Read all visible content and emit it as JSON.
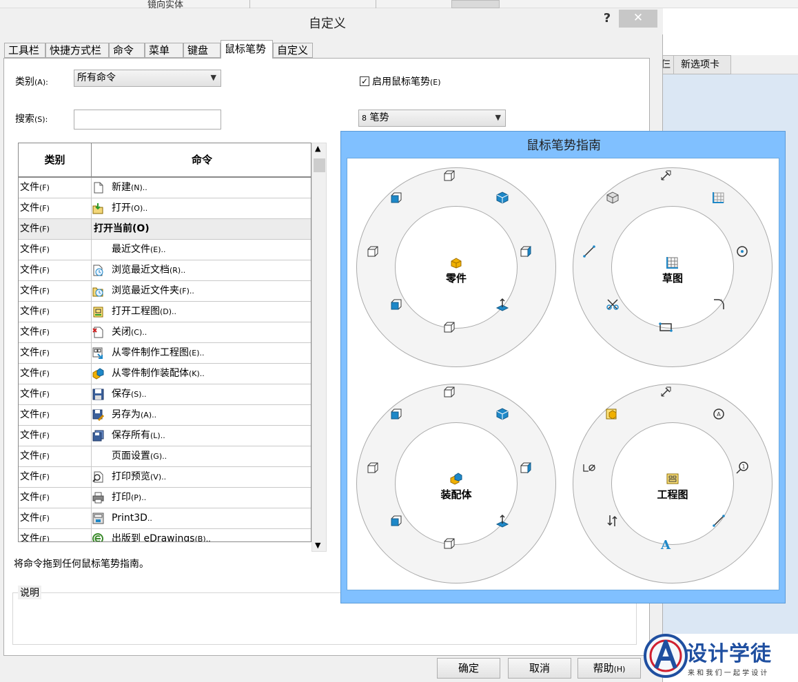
{
  "background": {
    "top_text": "镜向实体",
    "right_tab_partial": "仨",
    "right_tab": "新选项卡"
  },
  "dialog": {
    "title": "自定义",
    "help": "?",
    "close": "✕",
    "tabs": [
      {
        "label": "工具栏"
      },
      {
        "label": "快捷方式栏"
      },
      {
        "label": "命令"
      },
      {
        "label": "菜单"
      },
      {
        "label": "键盘"
      },
      {
        "label": "鼠标笔势"
      },
      {
        "label": "自定义"
      }
    ],
    "active_tab": "鼠标笔势"
  },
  "filters": {
    "category_label": "类别",
    "category_key": "(A):",
    "category_value": "所有命令",
    "search_label": "搜索",
    "search_key": "(S):",
    "search_value": "",
    "enable_label": "启用鼠标笔势",
    "enable_key": "(E)",
    "enable_checked": true,
    "gesture_count": "8",
    "gesture_unit": "笔势"
  },
  "table": {
    "headers": [
      "类别",
      "命令"
    ],
    "rows": [
      {
        "cat": "文件",
        "key": "(F)",
        "cmd": "新建",
        "cmd_key": "(N)..",
        "icon": "new-doc-icon"
      },
      {
        "cat": "文件",
        "key": "(F)",
        "cmd": "打开",
        "cmd_key": "(O)..",
        "icon": "open-icon"
      },
      {
        "cat": "文件",
        "key": "(F)",
        "cmd": "打开当前",
        "cmd_key": "(O)",
        "icon": "",
        "bold": true
      },
      {
        "cat": "文件",
        "key": "(F)",
        "cmd": "最近文件",
        "cmd_key": "(E)..",
        "icon": ""
      },
      {
        "cat": "文件",
        "key": "(F)",
        "cmd": "浏览最近文档",
        "cmd_key": "(R)..",
        "icon": "recent-doc-icon"
      },
      {
        "cat": "文件",
        "key": "(F)",
        "cmd": "浏览最近文件夹",
        "cmd_key": "(F)..",
        "icon": "recent-folder-icon"
      },
      {
        "cat": "文件",
        "key": "(F)",
        "cmd": "打开工程图",
        "cmd_key": "(D)..",
        "icon": "open-drawing-icon"
      },
      {
        "cat": "文件",
        "key": "(F)",
        "cmd": "关闭",
        "cmd_key": "(C)..",
        "icon": "close-doc-icon"
      },
      {
        "cat": "文件",
        "key": "(F)",
        "cmd": "从零件制作工程图",
        "cmd_key": "(E)..",
        "icon": "make-drawing-icon"
      },
      {
        "cat": "文件",
        "key": "(F)",
        "cmd": "从零件制作装配体",
        "cmd_key": "(K)..",
        "icon": "make-assembly-icon"
      },
      {
        "cat": "文件",
        "key": "(F)",
        "cmd": "保存",
        "cmd_key": "(S)..",
        "icon": "save-icon"
      },
      {
        "cat": "文件",
        "key": "(F)",
        "cmd": "另存为",
        "cmd_key": "(A)..",
        "icon": "save-as-icon"
      },
      {
        "cat": "文件",
        "key": "(F)",
        "cmd": "保存所有",
        "cmd_key": "(L)..",
        "icon": "save-all-icon"
      },
      {
        "cat": "文件",
        "key": "(F)",
        "cmd": "页面设置",
        "cmd_key": "(G)..",
        "icon": ""
      },
      {
        "cat": "文件",
        "key": "(F)",
        "cmd": "打印预览",
        "cmd_key": "(V)..",
        "icon": "print-preview-icon"
      },
      {
        "cat": "文件",
        "key": "(F)",
        "cmd": "打印",
        "cmd_key": "(P)..",
        "icon": "print-icon"
      },
      {
        "cat": "文件",
        "key": "(F)",
        "cmd": "Print3D",
        "cmd_key": "..",
        "icon": "print3d-icon"
      },
      {
        "cat": "文件",
        "key": "(F)",
        "cmd": "出版到 eDrawings",
        "cmd_key": "(B)..",
        "icon": "edrawings-icon"
      }
    ]
  },
  "guide": {
    "title": "鼠标笔势指南",
    "wheels": [
      {
        "label": "零件"
      },
      {
        "label": "草图"
      },
      {
        "label": "装配体"
      },
      {
        "label": "工程图"
      }
    ]
  },
  "hint": "将命令拖到任何鼠标笔势指南。",
  "description_label": "说明",
  "buttons": {
    "ok": "确定",
    "cancel": "取消",
    "help": "帮助",
    "help_key": "(H)"
  },
  "watermark": {
    "brand": "设计学徒",
    "slogan": "来 和 我 们 一 起 学 设 计"
  },
  "colors": {
    "guide_border": "#80c0ff",
    "icon_blue": "#1e88c8",
    "icon_yellow": "#f0b000"
  }
}
